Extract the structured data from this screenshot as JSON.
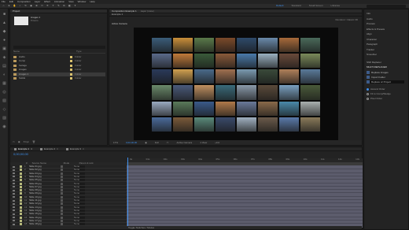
{
  "menubar": [
    "File",
    "Edit",
    "Composition",
    "Layer",
    "Effect",
    "Animation",
    "View",
    "Window",
    "Help"
  ],
  "workspaces": {
    "items": [
      "Default",
      "Standard",
      "Small Screen",
      "Libraries"
    ],
    "active": "Default"
  },
  "project": {
    "title": "Project",
    "item_name": "images 1",
    "item_info": "8 items",
    "columns": [
      "Name",
      "Type"
    ],
    "rows": [
      {
        "name": "Audio",
        "type": "Folder"
      },
      {
        "name": "Comp",
        "type": "Folder"
      },
      {
        "name": "footage",
        "type": "Folder"
      },
      {
        "name": "images",
        "type": "Folder"
      },
      {
        "name": "images 1",
        "type": "Folder",
        "selected": true
      },
      {
        "name": "Solids",
        "type": "Folder"
      }
    ],
    "footer": "8 bpc"
  },
  "composition": {
    "tab": "Composition Example 1",
    "layer_tab": "Layer (none)",
    "subtab": "Example 1",
    "active_camera": "Active Camera",
    "renderer": "Renderer: Classic 3D",
    "footer": {
      "zoom": "17%",
      "timecode": "0;00;00;00",
      "quality": "Full",
      "camera": "Active Camera",
      "views": "1 View",
      "plus": "+0.0"
    }
  },
  "tiles": [
    "#3b5d7a",
    "#c98f3a",
    "#5a7a4a",
    "#7c4a2a",
    "#2e4a6a",
    "#6a8aaa",
    "#a86a3a",
    "#4a6a5a",
    "#5a6a8a",
    "#c07a3a",
    "#3a5a3a",
    "#8a5a3a",
    "#4a7aaa",
    "#9ab0c0",
    "#6a4a3a",
    "#7a8a5a",
    "#2a3a5a",
    "#d0a050",
    "#4a6a8a",
    "#a07050",
    "#7a9ab0",
    "#3a4a3a",
    "#b0805a",
    "#5a7a9a",
    "#6a8a6a",
    "#4a5a7a",
    "#c09060",
    "#3a6a7a",
    "#8a9aaa",
    "#5a4a3a",
    "#7aa0c0",
    "#4a5a3a",
    "#9aaac0",
    "#5a7a5a",
    "#3a5a8a",
    "#b07a4a",
    "#6a7a9a",
    "#8a6a4a",
    "#4a8aaa",
    "#aab0b0",
    "#4a6a9a",
    "#7a5a3a",
    "#5a8a7a",
    "#3a4a6a",
    "#a0b0c0",
    "#6a5a4a",
    "#5a7aaa",
    "#8a7a5a"
  ],
  "right_panel": {
    "sections": [
      "Info",
      "Audio",
      "Preview",
      "Effects & Presets",
      "Align",
      "Character",
      "Paragraph",
      "Tracker",
      "Smoother"
    ],
    "effect_name": "Shift Replacer",
    "script_title": "MULTI REPLACER",
    "buttons": [
      "Replace Images",
      "Import Folder",
      "Replace w/ Project"
    ],
    "options": [
      "Ascend Order",
      "Fit to Comp/Wedge",
      "Pixel Order"
    ]
  },
  "timeline": {
    "tabs": [
      "Example 1",
      "Example 2",
      "Example 3"
    ],
    "active_tab": "Example 1",
    "timecode": "0;00;00;00",
    "columns": [
      "#",
      "Source Name",
      "Mode",
      "Parent & Link"
    ],
    "layers": [
      {
        "num": "1",
        "name": "Slide 01.jpg",
        "parent": "None"
      },
      {
        "num": "2",
        "name": "Slide 02.jpg",
        "parent": "None"
      },
      {
        "num": "3",
        "name": "Slide 03.jpg",
        "parent": "None"
      },
      {
        "num": "4",
        "name": "Slide 04.jpg",
        "parent": "None"
      },
      {
        "num": "5",
        "name": "Slide 05.jpg",
        "parent": "None"
      },
      {
        "num": "6",
        "name": "Slide 06.jpg",
        "parent": "None"
      },
      {
        "num": "7",
        "name": "Slide 07.jpg",
        "parent": "None"
      },
      {
        "num": "8",
        "name": "Slide 08.jpg",
        "parent": "None"
      },
      {
        "num": "9",
        "name": "Slide 09.jpg",
        "parent": "None"
      },
      {
        "num": "10",
        "name": "Slide 10.jpg",
        "parent": "None"
      },
      {
        "num": "11",
        "name": "Slide 11.jpg",
        "parent": "None"
      },
      {
        "num": "12",
        "name": "Slide 12.jpg",
        "parent": "None"
      },
      {
        "num": "13",
        "name": "Slide 13.jpg",
        "parent": "None"
      },
      {
        "num": "14",
        "name": "Slide 14.jpg",
        "parent": "None"
      },
      {
        "num": "15",
        "name": "Slide 15.jpg",
        "parent": "None"
      },
      {
        "num": "16",
        "name": "Slide 16.jpg",
        "parent": "None"
      },
      {
        "num": "17",
        "name": "Slide 17.jpg",
        "parent": "None"
      },
      {
        "num": "18",
        "name": "Slide 18.jpg",
        "parent": "None"
      }
    ],
    "ruler": [
      "0s",
      "01s",
      "02s",
      "03s",
      "04s",
      "05s",
      "06s",
      "07s",
      "08s",
      "09s",
      "10s",
      "11s",
      "12s",
      "13s"
    ],
    "footer": "Toggle Switches / Modes"
  }
}
